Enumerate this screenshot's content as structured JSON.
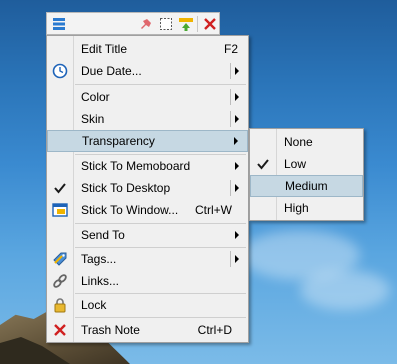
{
  "menu": {
    "items": [
      {
        "label": "Edit Title",
        "shortcut": "F2"
      },
      {
        "label": "Due Date..."
      },
      {
        "label": "Color"
      },
      {
        "label": "Skin"
      },
      {
        "label": "Transparency"
      },
      {
        "label": "Stick To Memoboard"
      },
      {
        "label": "Stick To Desktop"
      },
      {
        "label": "Stick To Window...",
        "shortcut": "Ctrl+W"
      },
      {
        "label": "Send To"
      },
      {
        "label": "Tags..."
      },
      {
        "label": "Links..."
      },
      {
        "label": "Lock"
      },
      {
        "label": "Trash Note",
        "shortcut": "Ctrl+D"
      }
    ]
  },
  "transparency_submenu": {
    "items": [
      {
        "label": "None"
      },
      {
        "label": "Low"
      },
      {
        "label": "Medium"
      },
      {
        "label": "High"
      }
    ],
    "checked": "Low",
    "highlighted": "Medium"
  },
  "colors": {
    "highlight": "#c6d8e3",
    "menu_bg": "#f0f0f0"
  },
  "icons": [
    "menu-icon",
    "pin-icon",
    "note-icon",
    "stick-icon",
    "close-icon",
    "clock-icon",
    "check-icon",
    "window-icon",
    "tag-icon",
    "link-icon",
    "lock-icon",
    "trash-icon"
  ]
}
